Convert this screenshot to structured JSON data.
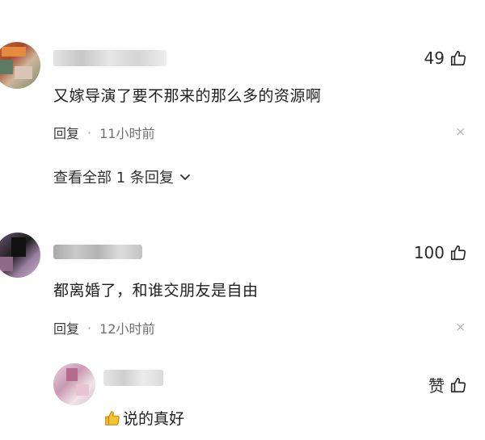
{
  "comments": [
    {
      "likes": "49",
      "text": "又嫁导演了要不那来的那么多的资源啊",
      "reply_label": "回复",
      "separator": "·",
      "time": "11小时前",
      "close_glyph": "×",
      "view_replies": "查看全部 1 条回复"
    },
    {
      "likes": "100",
      "text": "都离婚了，和谁交朋友是自由",
      "reply_label": "回复",
      "separator": "·",
      "time": "12小时前",
      "close_glyph": "×"
    }
  ],
  "reply": {
    "like_label": "赞",
    "text": "说的真好"
  },
  "icons": {
    "like": "thumbs-up-icon",
    "close": "close-icon",
    "chevron": "chevron-down-icon"
  },
  "colors": {
    "text_primary": "#1e1e1e",
    "text_secondary": "#6f6f6f",
    "icon_gray": "#b3b3b3",
    "emoji_yellow": "#f5c230"
  }
}
